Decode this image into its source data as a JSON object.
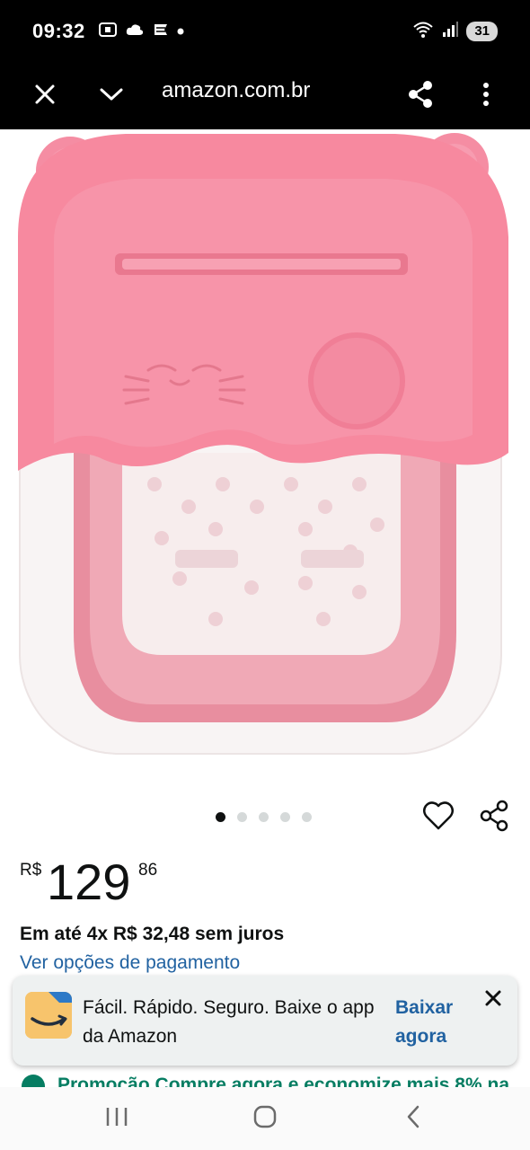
{
  "status_bar": {
    "time": "09:32",
    "battery": "31",
    "icons": [
      "screenshot-icon",
      "cloud-icon",
      "app-notification-icon",
      "dot-icon",
      "wifi-icon",
      "signal-icon"
    ]
  },
  "browser": {
    "url": "amazon.com.br",
    "icons": [
      "close-icon",
      "chevron-down-icon",
      "share-icon",
      "more-vert-icon"
    ]
  },
  "product": {
    "image_alt_icon": "foot-spa-basin-image",
    "carousel_total": 5,
    "carousel_active": 1
  },
  "price": {
    "symbol": "R$",
    "whole": "129",
    "fraction": "86"
  },
  "installments": "Em até 4x R$ 32,48 sem juros",
  "payment_link": "Ver opções de pagamento",
  "app_banner": {
    "text": "Fácil. Rápido. Seguro. Baixe o app da Amazon",
    "cta": "Baixar agora"
  },
  "promo": {
    "text": "Promoção Compre agora e economize mais 8% na"
  },
  "nav": {
    "icons": [
      "recents-icon",
      "home-icon",
      "back-icon"
    ]
  },
  "colors": {
    "link": "#2162a1",
    "product_pink": "#f47f98",
    "promo_green": "#067d62"
  }
}
